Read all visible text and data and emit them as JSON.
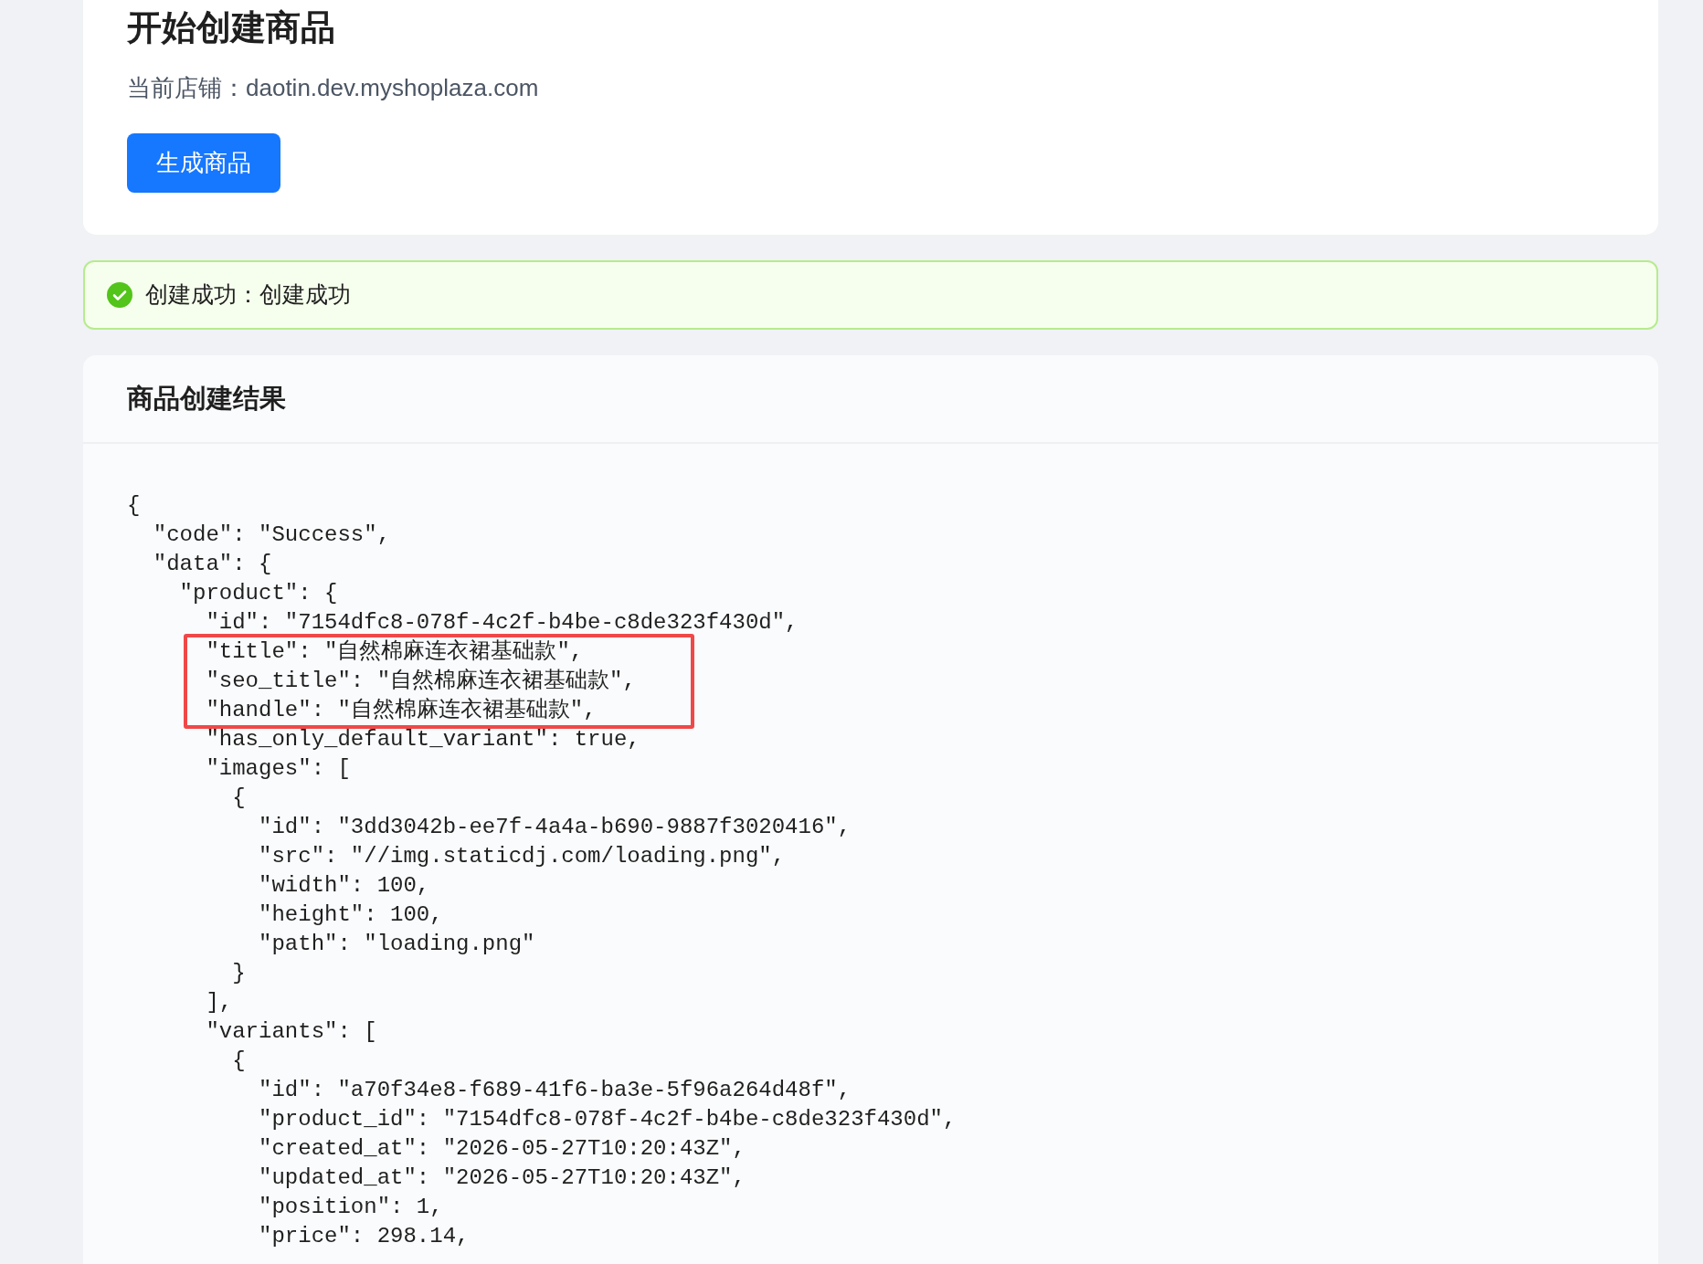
{
  "header": {
    "title": "开始创建商品",
    "store_label": "当前店铺：",
    "store_value": "daotin.dev.myshoplaza.com",
    "button": "生成商品"
  },
  "alert": {
    "kind": "success",
    "message": "创建成功：创建成功"
  },
  "result": {
    "title": "商品创建结果",
    "code_blocks": [
      {
        "highlighted": false,
        "lines": [
          "{",
          "  \"code\": \"Success\",",
          "  \"data\": {",
          "    \"product\": {",
          "      \"id\": \"7154dfc8-078f-4c2f-b4be-c8de323f430d\","
        ]
      },
      {
        "highlighted": true,
        "lines": [
          "      \"title\": \"自然棉麻连衣裙基础款\",",
          "      \"seo_title\": \"自然棉麻连衣裙基础款\",",
          "      \"handle\": \"自然棉麻连衣裙基础款\","
        ]
      },
      {
        "highlighted": false,
        "lines": [
          "      \"has_only_default_variant\": true,",
          "      \"images\": [",
          "        {",
          "          \"id\": \"3dd3042b-ee7f-4a4a-b690-9887f3020416\",",
          "          \"src\": \"//img.staticdj.com/loading.png\",",
          "          \"width\": 100,",
          "          \"height\": 100,",
          "          \"path\": \"loading.png\"",
          "        }",
          "      ],",
          "      \"variants\": [",
          "        {",
          "          \"id\": \"a70f34e8-f689-41f6-ba3e-5f96a264d48f\",",
          "          \"product_id\": \"7154dfc8-078f-4c2f-b4be-c8de323f430d\",",
          "          \"created_at\": \"2026-05-27T10:20:43Z\",",
          "          \"updated_at\": \"2026-05-27T10:20:43Z\",",
          "          \"position\": 1,",
          "          \"price\": 298.14,"
        ]
      }
    ]
  }
}
